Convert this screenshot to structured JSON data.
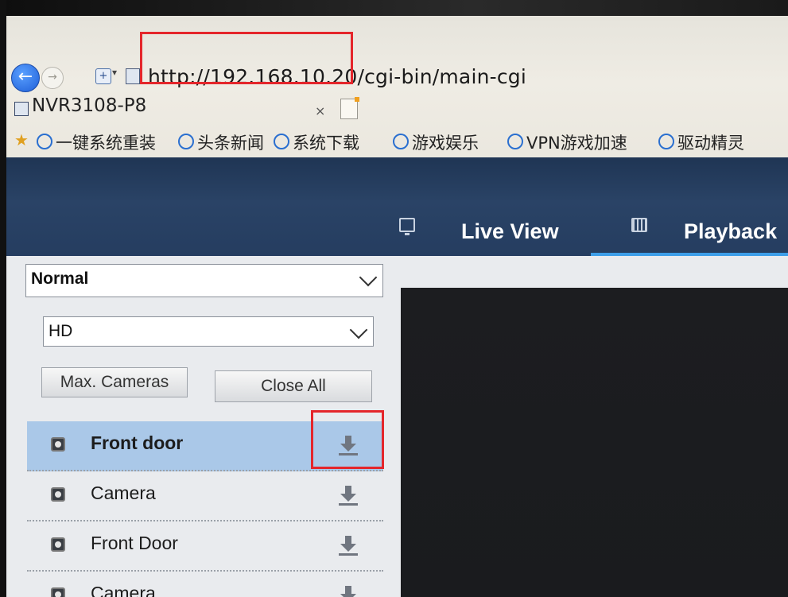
{
  "browser": {
    "address_url": "http://192.168.10.20/cgi-bin/main-cgi",
    "tab_title": "NVR3108-P8",
    "tab_close": "×",
    "favorites": [
      {
        "label": "一键系统重装"
      },
      {
        "label": "头条新闻"
      },
      {
        "label": "系统下载"
      },
      {
        "label": "游戏娱乐"
      },
      {
        "label": "VPN游戏加速"
      },
      {
        "label": "驱动精灵"
      }
    ]
  },
  "app": {
    "nav": {
      "live_view": "Live View",
      "playback": "Playback"
    },
    "stream_mode": {
      "selected": "Normal"
    },
    "quality": {
      "selected": "HD"
    },
    "buttons": {
      "max_cameras": "Max. Cameras",
      "close_all": "Close All"
    },
    "cameras": [
      {
        "name": "Front door",
        "active": true
      },
      {
        "name": "Camera",
        "active": false
      },
      {
        "name": "Front Door",
        "active": false
      },
      {
        "name": "Camera",
        "active": false
      }
    ]
  },
  "colors": {
    "highlight_box": "#e4262b",
    "header_bg": "#253d60",
    "selected_row": "#aac8e8",
    "accent_underline": "#3d9ee8"
  }
}
